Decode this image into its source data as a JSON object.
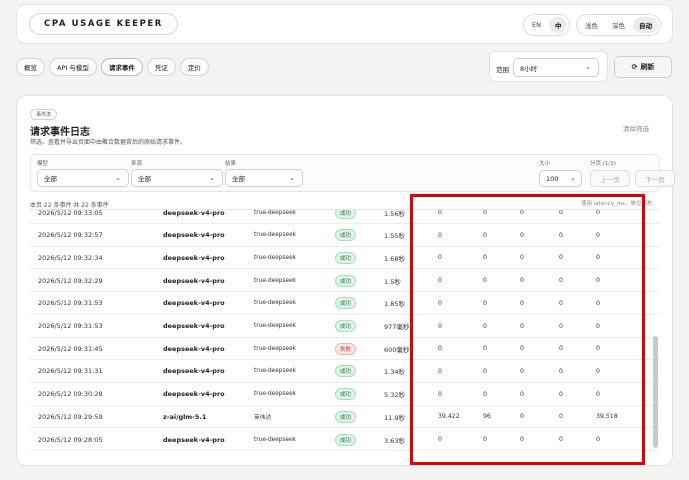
{
  "header": {
    "brand": "CPA USAGE KEEPER",
    "languages": [
      "EN",
      "中"
    ],
    "active_language": "中",
    "themes": [
      "浅色",
      "深色",
      "自动"
    ],
    "active_theme": "自动"
  },
  "tabs": [
    {
      "label": "概览",
      "active": false
    },
    {
      "label": "API 与模型",
      "active": false
    },
    {
      "label": "请求事件",
      "active": true
    },
    {
      "label": "凭证",
      "active": false
    },
    {
      "label": "定价",
      "active": false
    }
  ],
  "range": {
    "label": "范围",
    "value": "8小时"
  },
  "refresh_label": "刷新",
  "panel": {
    "chip": "事件流",
    "title": "请求事件日志",
    "subtitle": "筛选、查看并导出页面中由聚合数据背后的原始请求事件。",
    "clear_label": "清除筛选"
  },
  "filters": {
    "model": {
      "label": "模型",
      "value": "全部"
    },
    "source": {
      "label": "来源",
      "value": "全部"
    },
    "result": {
      "label": "结果",
      "value": "全部"
    },
    "size": {
      "label": "大小",
      "value": "100"
    },
    "pagination": {
      "label": "分页 (1/1)",
      "prev": "上一页",
      "next": "下一页"
    }
  },
  "summary": "本页 22 条事件  共 22 条事件",
  "hint": "使用 latency_ms，单位毫秒",
  "rows": [
    {
      "time": "2026/5/12 09:33:05",
      "model": "deepseek-v4-pro",
      "source": "true-deepseek",
      "status": "成功",
      "ok": true,
      "latency": "1.56秒",
      "c1": "0",
      "c2": "0",
      "c3": "0",
      "c4": "0",
      "c5": "0"
    },
    {
      "time": "2026/5/12 09:32:57",
      "model": "deepseek-v4-pro",
      "source": "true-deepseek",
      "status": "成功",
      "ok": true,
      "latency": "1.55秒",
      "c1": "0",
      "c2": "0",
      "c3": "0",
      "c4": "0",
      "c5": "0"
    },
    {
      "time": "2026/5/12 09:32:34",
      "model": "deepseek-v4-pro",
      "source": "true-deepseek",
      "status": "成功",
      "ok": true,
      "latency": "1.68秒",
      "c1": "0",
      "c2": "0",
      "c3": "0",
      "c4": "0",
      "c5": "0"
    },
    {
      "time": "2026/5/12 09:32:29",
      "model": "deepseek-v4-pro",
      "source": "true-deepseek",
      "status": "成功",
      "ok": true,
      "latency": "1.5秒",
      "c1": "0",
      "c2": "0",
      "c3": "0",
      "c4": "0",
      "c5": "0"
    },
    {
      "time": "2026/5/12 09:31:53",
      "model": "deepseek-v4-pro",
      "source": "true-deepseek",
      "status": "成功",
      "ok": true,
      "latency": "1.85秒",
      "c1": "0",
      "c2": "0",
      "c3": "0",
      "c4": "0",
      "c5": "0"
    },
    {
      "time": "2026/5/12 09:31:53",
      "model": "deepseek-v4-pro",
      "source": "true-deepseek",
      "status": "成功",
      "ok": true,
      "latency": "977毫秒",
      "c1": "0",
      "c2": "0",
      "c3": "0",
      "c4": "0",
      "c5": "0"
    },
    {
      "time": "2026/5/12 09:31:45",
      "model": "deepseek-v4-pro",
      "source": "true-deepseek",
      "status": "失败",
      "ok": false,
      "latency": "600毫秒",
      "c1": "0",
      "c2": "0",
      "c3": "0",
      "c4": "0",
      "c5": "0"
    },
    {
      "time": "2026/5/12 09:31:31",
      "model": "deepseek-v4-pro",
      "source": "true-deepseek",
      "status": "成功",
      "ok": true,
      "latency": "1.34秒",
      "c1": "0",
      "c2": "0",
      "c3": "0",
      "c4": "0",
      "c5": "0"
    },
    {
      "time": "2026/5/12 09:30:28",
      "model": "deepseek-v4-pro",
      "source": "true-deepseek",
      "status": "成功",
      "ok": true,
      "latency": "5.32秒",
      "c1": "0",
      "c2": "0",
      "c3": "0",
      "c4": "0",
      "c5": "0"
    },
    {
      "time": "2026/5/12 09:29:59",
      "model": "z-ai/glm-5.1",
      "source": "英伟达",
      "status": "成功",
      "ok": true,
      "latency": "11.9秒",
      "c1": "39,422",
      "c2": "96",
      "c3": "0",
      "c4": "0",
      "c5": "39,518"
    },
    {
      "time": "2026/5/12 09:28:05",
      "model": "deepseek-v4-pro",
      "source": "true-deepseek",
      "status": "成功",
      "ok": true,
      "latency": "3.63秒",
      "c1": "0",
      "c2": "0",
      "c3": "0",
      "c4": "0",
      "c5": "0"
    }
  ],
  "colors": {
    "highlight": "#e00000",
    "success": "#1e7a44",
    "failure": "#b73a3a"
  }
}
